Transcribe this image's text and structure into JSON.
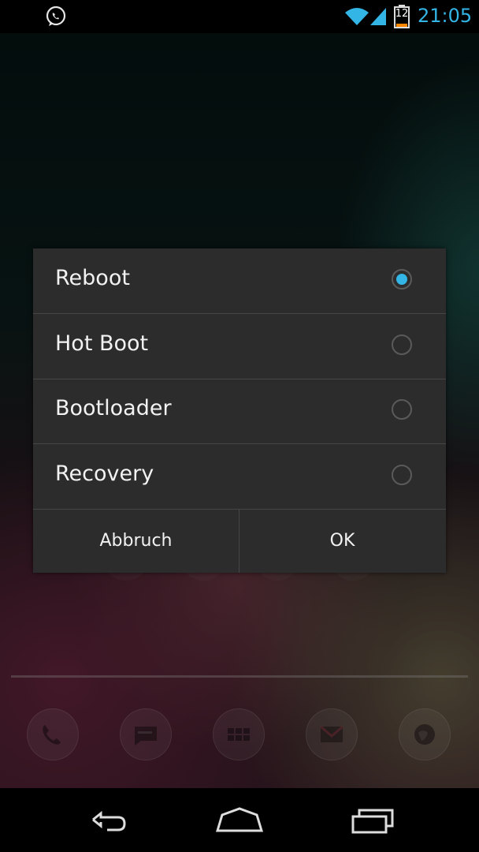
{
  "status_bar": {
    "time": "21:05",
    "battery_level": "12",
    "notification_icon": "whatsapp-icon",
    "icons": [
      "wifi-icon",
      "signal-icon",
      "battery-icon"
    ],
    "accent_color": "#33b5e5"
  },
  "dialog": {
    "options": [
      {
        "label": "Reboot",
        "selected": true
      },
      {
        "label": "Hot Boot",
        "selected": false
      },
      {
        "label": "Bootloader",
        "selected": false
      },
      {
        "label": "Recovery",
        "selected": false
      }
    ],
    "cancel_label": "Abbruch",
    "ok_label": "OK"
  },
  "dock": {
    "icons": [
      "phone-icon",
      "messaging-icon",
      "app-drawer-icon",
      "gmail-icon",
      "browser-icon"
    ]
  },
  "nav_bar": {
    "buttons": [
      "back-icon",
      "home-icon",
      "recent-apps-icon"
    ]
  }
}
